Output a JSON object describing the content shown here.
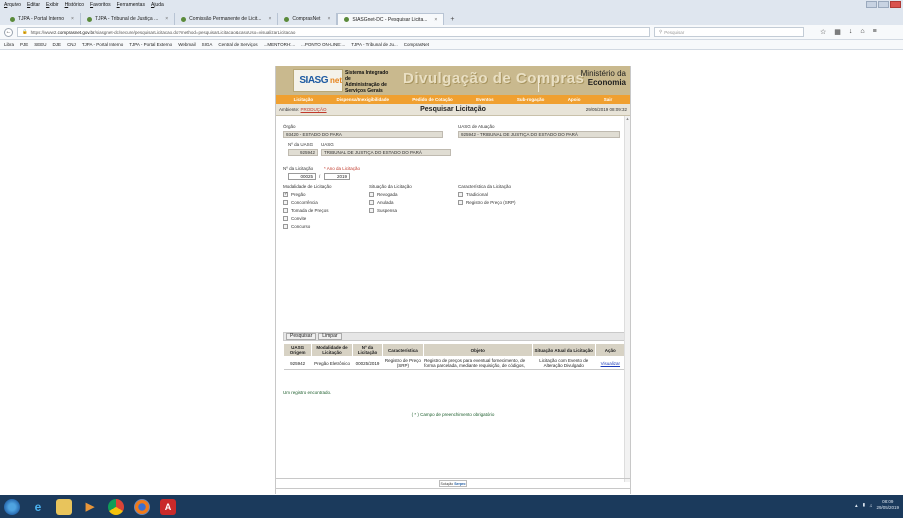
{
  "browser": {
    "menu": [
      "Arquivo",
      "Editar",
      "Exibir",
      "Histórico",
      "Favoritos",
      "Ferramentas",
      "Ajuda"
    ],
    "tabs": [
      {
        "label": "TJPA - Portal Interno",
        "active": false
      },
      {
        "label": "TJPA - Tribunal de Justiça ...",
        "active": false
      },
      {
        "label": "Comissão Permanente de Licit...",
        "active": false
      },
      {
        "label": "ComprasNet",
        "active": false
      },
      {
        "label": "SIASGnet-DC - Pesquisar Licita...",
        "active": true
      }
    ],
    "new_tab": "+",
    "url_prefix": "https://www2.",
    "url_domain": "comprasnet.gov.br",
    "url_rest": "/siasgnet-dc/secure/pesquisarLicitacao.do?method=pesquisarLicitacao&casoUso=visualizarLicitacao",
    "search_placeholder": "Pesquisar",
    "bookmarks": [
      "Libra",
      "PJE",
      "SEEU",
      "DJE",
      "CNJ",
      "TJPA - Portal Interno",
      "TJPA - Portal Externo",
      "Webmail",
      "SIGA",
      "Central de Serviços",
      "...MENTORH:...",
      "...PONTO ON-LINE:...",
      "TJPA - Tribunal de Ju...",
      "ComprasNet"
    ]
  },
  "banner": {
    "siasg": "SIASG",
    "net": "net",
    "system_line1": "Sistema Integrado de",
    "system_line2": "Administração de",
    "system_line3": "Serviços Gerais",
    "divulgacao": "Divulgação de Compras",
    "ministerio_line1": "Ministério da",
    "ministerio_line2": "Economia"
  },
  "menu": [
    "Licitação",
    "Dispensa/Inexigibilidade",
    "Pedido de Cotação",
    "Eventos",
    "Sub-rogação",
    "Apoio",
    "Sair"
  ],
  "titlebar": {
    "ambiente_label": "Ambiente:",
    "ambiente_value": "PRODUÇÃO",
    "title": "Pesquisar Licitação",
    "datetime": "29/05/2019 08:09:32"
  },
  "form": {
    "orgao_label": "Órgão",
    "orgao_value": "93420 - ESTADO DO PARA",
    "uasg_atuacao_label": "UASG de Atuação",
    "uasg_atuacao_value": "925942 - TRIBUNAL DE JUSTIÇA DO ESTADO DO PARÁ",
    "nr_uasg_label": "Nº da UASG",
    "uasg_label": "UASG",
    "nr_uasg_value": "925942",
    "uasg_value": "TRIBUNAL DE JUSTIÇA DO ESTADO DO PARÁ",
    "nr_licitacao_label": "Nº da Licitação",
    "ano_label": "* Ano da Licitação",
    "nr_licitacao_value": "00025",
    "slash": "/",
    "ano_value": "2019",
    "modalidade_label": "Modalidade de Licitação",
    "modalidades": [
      {
        "label": "Pregão",
        "checked": true
      },
      {
        "label": "Concorrência",
        "checked": false
      },
      {
        "label": "Tomada de Preços",
        "checked": false
      },
      {
        "label": "Convite",
        "checked": false
      },
      {
        "label": "Concurso",
        "checked": false
      }
    ],
    "situacao_label": "Situação da Licitação",
    "situacoes": [
      {
        "label": "Revogada",
        "checked": false
      },
      {
        "label": "Anulada",
        "checked": false
      },
      {
        "label": "Suspensa",
        "checked": false
      }
    ],
    "caracteristica_label": "Característica da Licitação",
    "caracteristicas": [
      {
        "label": "Tradicional",
        "checked": false
      },
      {
        "label": "Registro de Preço (SRP)",
        "checked": false
      }
    ]
  },
  "buttons": {
    "pesquisar": "Pesquisar",
    "limpar": "Limpar"
  },
  "results": {
    "headers": [
      "UASG Origem",
      "Modalidade de Licitação",
      "Nº da Licitação",
      "Característica",
      "Objeto",
      "Situação Atual da Licitação",
      "Ação"
    ],
    "rows": [
      {
        "uasg": "925942",
        "modalidade": "Pregão Eletrônico",
        "numero": "00025/2019",
        "caracteristica": "Registro de Preço (SRP)",
        "objeto": "Registro de preços para eventual fornecimento, de forma parcelada, mediante requisição, de códigos,",
        "situacao": "Licitação com Evento de Alteração Divulgado",
        "acao": "Visualizar"
      }
    ],
    "found_text": "Um registro encontrado."
  },
  "required_note": "( * ) Campo de preenchimento obrigatório",
  "footer": {
    "a": "Solução",
    "b": "Serpro"
  },
  "taskbar": {
    "time": "08:09",
    "date": "29/05/2019"
  }
}
